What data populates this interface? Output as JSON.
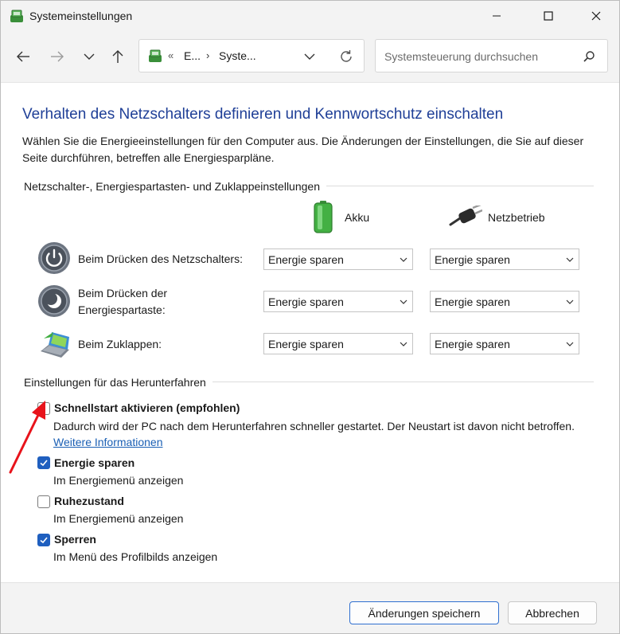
{
  "window": {
    "title": "Systemeinstellungen"
  },
  "address": {
    "overflow": "«",
    "crumb1": "E...",
    "chevron": "›",
    "crumb2": "Syste..."
  },
  "search": {
    "placeholder": "Systemsteuerung durchsuchen"
  },
  "page": {
    "title": "Verhalten des Netzschalters definieren und Kennwortschutz einschalten",
    "description": "Wählen Sie die Energieeinstellungen für den Computer aus. Die Änderungen der Einstellungen, die Sie auf dieser Seite durchführen, betreffen alle Energiesparpläne."
  },
  "buttons_section": {
    "heading": "Netzschalter-, Energiespartasten- und Zuklappeinstellungen",
    "columns": {
      "battery": "Akku",
      "plugged": "Netzbetrieb"
    },
    "rows": [
      {
        "label": "Beim Drücken des Netzschalters:",
        "battery": "Energie sparen",
        "plugged": "Energie sparen"
      },
      {
        "label": "Beim Drücken der Energiespartaste:",
        "battery": "Energie sparen",
        "plugged": "Energie sparen"
      },
      {
        "label": "Beim Zuklappen:",
        "battery": "Energie sparen",
        "plugged": "Energie sparen"
      }
    ]
  },
  "shutdown_section": {
    "heading": "Einstellungen für das Herunterfahren",
    "options": [
      {
        "label": "Schnellstart aktivieren (empfohlen)",
        "checked": false,
        "desc": "Dadurch wird der PC nach dem Herunterfahren schneller gestartet. Der Neustart ist davon nicht betroffen.",
        "link": "Weitere Informationen"
      },
      {
        "label": "Energie sparen",
        "checked": true,
        "desc": "Im Energiemenü anzeigen"
      },
      {
        "label": "Ruhezustand",
        "checked": false,
        "desc": "Im Energiemenü anzeigen"
      },
      {
        "label": "Sperren",
        "checked": true,
        "desc": "Im Menü des Profilbilds anzeigen"
      }
    ]
  },
  "footer": {
    "save_label": "Änderungen speichern",
    "cancel_label": "Abbrechen"
  },
  "colors": {
    "title_blue": "#1f3f97",
    "checkbox_blue": "#1f5fbf",
    "link_blue": "#1a5fb4",
    "annotation_red": "#e8131b"
  }
}
